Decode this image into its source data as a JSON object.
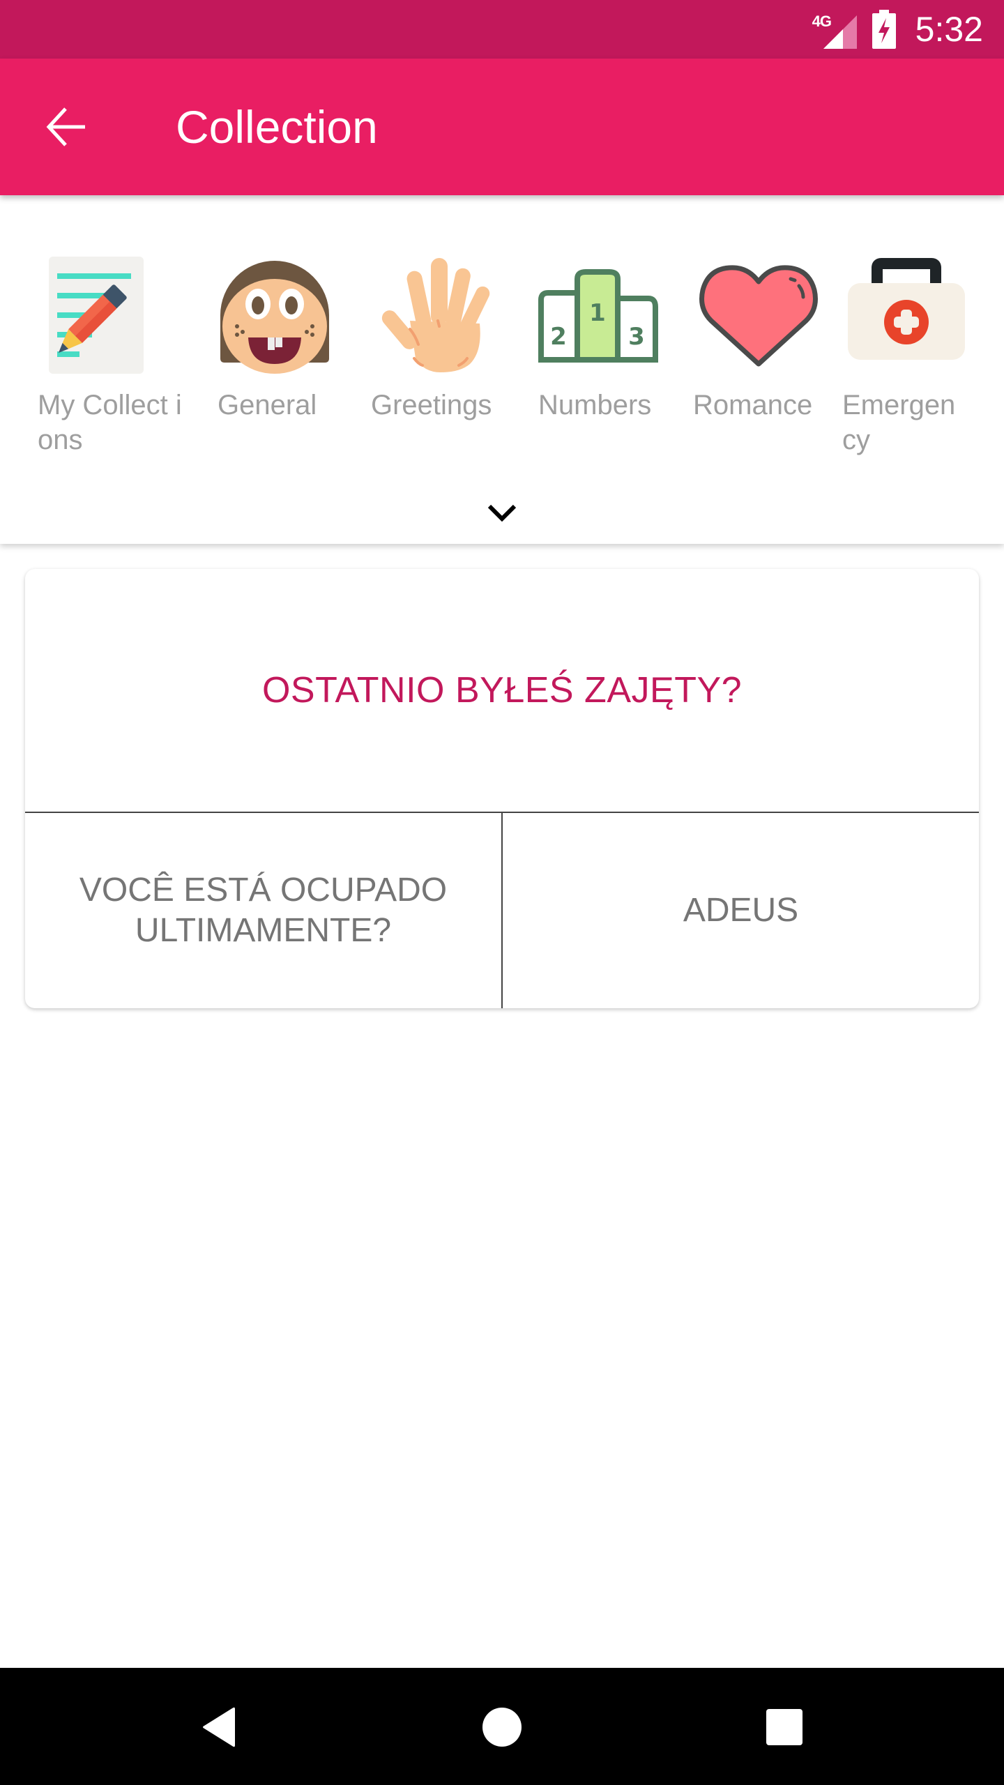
{
  "status_bar": {
    "network_label": "4G",
    "time": "5:32",
    "signal_icon": "cellular-signal-icon",
    "battery_icon": "battery-charging-icon",
    "color": "#c2185b"
  },
  "app_bar": {
    "title": "Collection",
    "back_icon": "arrow-back-icon",
    "color": "#e91e63"
  },
  "categories": {
    "items": [
      {
        "label": "My Collections",
        "display_label": "My Collect ions",
        "icon": "notepad-pencil-icon"
      },
      {
        "label": "General",
        "display_label": "General",
        "icon": "smiling-face-icon"
      },
      {
        "label": "Greetings",
        "display_label": "Greetings",
        "icon": "waving-hand-icon"
      },
      {
        "label": "Numbers",
        "display_label": "Numbers",
        "icon": "podium-icon"
      },
      {
        "label": "Romance",
        "display_label": "Romance",
        "icon": "heart-icon"
      },
      {
        "label": "Emergency",
        "display_label": "Emergen cy",
        "icon": "first-aid-kit-icon"
      }
    ],
    "expand_icon": "chevron-down-icon",
    "label_color": "#9e9e9e"
  },
  "quiz_card": {
    "question": "OSTATNIO BYŁEŚ ZAJĘTY?",
    "question_color": "#c2185b",
    "options": [
      {
        "text": "VOCÊ ESTÁ OCUPADO ULTIMAMENTE?"
      },
      {
        "text": "ADEUS"
      }
    ],
    "option_color": "#757575"
  },
  "nav_bar": {
    "back_icon": "nav-back-icon",
    "home_icon": "nav-home-icon",
    "recents_icon": "nav-recents-icon"
  }
}
